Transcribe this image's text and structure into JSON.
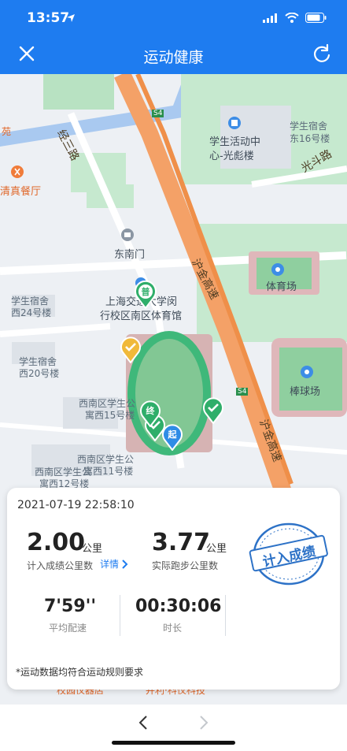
{
  "status_bar": {
    "time": "13:57"
  },
  "header": {
    "title": "运动健康"
  },
  "map": {
    "labels": {
      "dongnanmen": "东南门",
      "stadium_a": "上海交通大学闵",
      "stadium_b": "行校区南区体育馆",
      "activity_a": "学生活动中",
      "activity_b": "心-光彪楼",
      "dorm16_a": "学生宿舍",
      "dorm16_b": "东16号楼",
      "dorm24_a": "学生宿舍",
      "dorm24_b": "西24号楼",
      "dorm20_a": "学生宿舍",
      "dorm20_b": "西20号楼",
      "apt15_a": "西南区学生公",
      "apt15_b": "寓西15号楼",
      "apt11_a": "西南区学生公",
      "apt11_b": "寓西11号楼",
      "apt12_a": "西南区学生公",
      "apt12_b": "寓西12号楼",
      "gym": "体育场",
      "baseball": "棒球场",
      "restaurant": "清真餐厅",
      "garden": "苑",
      "road_jingsan": "经三路",
      "road_guangdou": "光斗路",
      "highway_a": "沪金高速",
      "highway_b": "沪金高速",
      "s4_a": "S4",
      "s4_b": "S4",
      "bottom_shop_a": "校园仪器店",
      "bottom_shop_b": "并利·科仪科技"
    },
    "markers": {
      "pu": "普",
      "zhong": "终",
      "qi": "起"
    }
  },
  "summary": {
    "datetime": "2021-07-19 22:58:10",
    "counted_km": "2.00",
    "counted_unit": "公里",
    "counted_label": "计入成绩公里数",
    "details_link": "详情",
    "actual_km": "3.77",
    "actual_unit": "公里",
    "actual_label": "实际跑步公里数",
    "stamp": "计入成绩",
    "pace": "7'59''",
    "pace_label": "平均配速",
    "duration": "00:30:06",
    "duration_label": "时长",
    "note": "*运动数据均符合运动规则要求"
  }
}
